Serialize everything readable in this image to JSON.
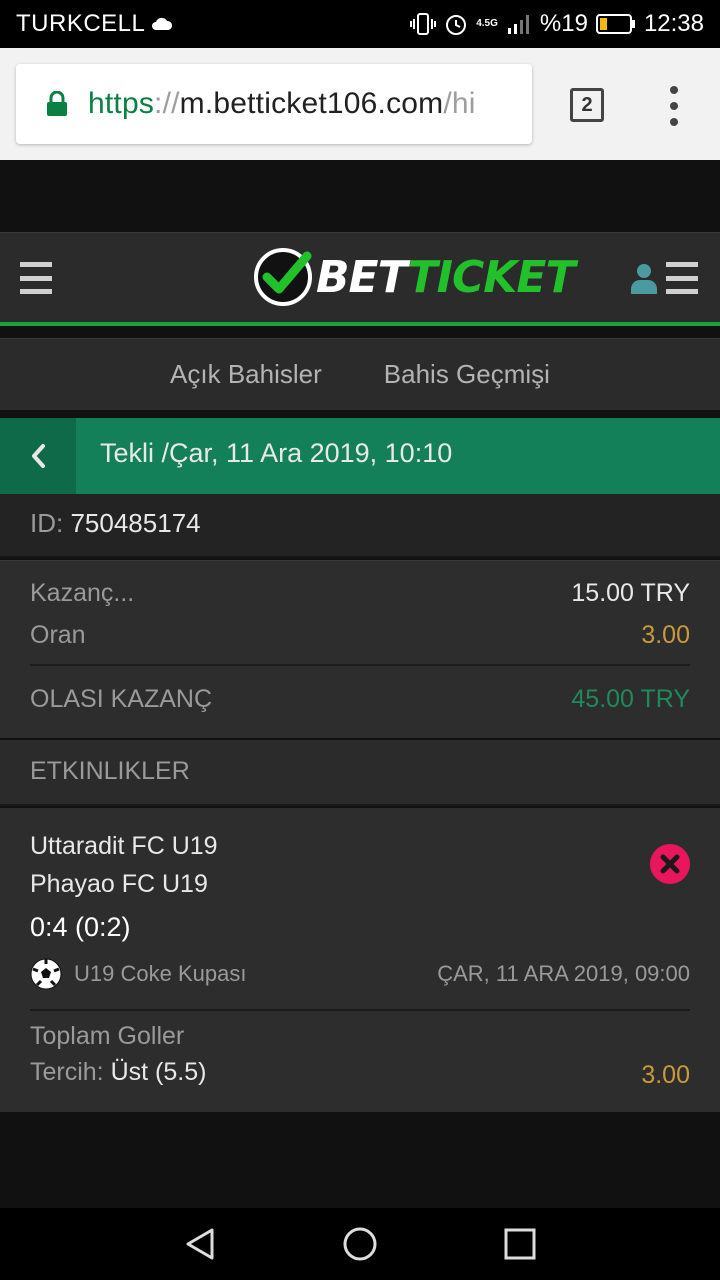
{
  "status_bar": {
    "carrier": "TURKCELL",
    "network": "4.5G",
    "battery": "%19",
    "time": "12:38"
  },
  "browser": {
    "url_scheme": "https",
    "url_sep": "://",
    "url_host": "m.betticket106.com",
    "url_path": "/hi",
    "tab_count": "2"
  },
  "site": {
    "logo_white": "BET",
    "logo_green": "TICKET"
  },
  "tabs": [
    "Açık Bahisler",
    "Bahis Geçmişi"
  ],
  "bet": {
    "title": "Tekli /Çar, 11 Ara 2019, 10:10",
    "id_label": "ID:",
    "id_value": "750485174",
    "stake_label": "Kazanç...",
    "stake_value": "15.00 TRY",
    "odds_label": "Oran",
    "odds_value": "3.00",
    "potential_label": "OLASI KAZANÇ",
    "potential_value": "45.00 TRY"
  },
  "events": {
    "header": "ETKINLIKLER",
    "items": [
      {
        "home": "Uttaradit FC U19",
        "away": "Phayao FC U19",
        "score": "0:4 (0:2)",
        "league": "U19 Coke Kupası",
        "date": "ÇAR, 11 ARA 2019, 09:00",
        "market": "Toplam Goller",
        "pick_label": "Tercih:",
        "pick_value": "Üst (5.5)",
        "odds": "3.00",
        "status_icon": "lost-x-icon"
      }
    ]
  },
  "colors": {
    "brand_green": "#14805a",
    "accent_green": "#1aa33b",
    "odds_orange": "#c99a3a",
    "lost_red": "#e8175d"
  }
}
